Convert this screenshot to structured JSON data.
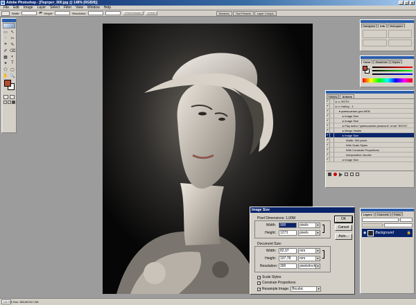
{
  "titlebar": {
    "title": "Adobe Photoshop - [Портрет_000.jpg @ 148% (RGB/8)]",
    "buttons": [
      "_",
      "□",
      "×"
    ]
  },
  "menu": [
    "File",
    "Edit",
    "Image",
    "Layer",
    "Select",
    "Filter",
    "View",
    "Window",
    "Help"
  ],
  "options_bar": {
    "width_label": "Width:",
    "height_label": "Height:",
    "resolution_label": "Resolution:",
    "front_image": "Front Image",
    "clear": "Clear"
  },
  "palette_well": [
    "Brushes",
    "Tool Presets",
    "Layer Comps"
  ],
  "colors": {
    "foreground": "#b34a32",
    "background": "#ffffff"
  },
  "tools": [
    "▭",
    "↖",
    "◌",
    "✂",
    "⌗",
    "✎",
    "✐",
    "⌫",
    "▦",
    "◐",
    "✦",
    "T",
    "⬠",
    "▢",
    "✋",
    "🔍"
  ],
  "navigator": {
    "tabs": [
      "Navigator",
      "Info",
      "Histogram"
    ]
  },
  "color_panel": {
    "tabs": [
      "Color",
      "Swatches",
      "Styles"
    ]
  },
  "history_actions": {
    "tabs": [
      "History",
      "Actions"
    ],
    "rows": [
      {
        "text": "ФОТО",
        "indent": 0,
        "type": "folder"
      },
      {
        "text": "Набор - 1",
        "indent": 0,
        "type": "folder"
      },
      {
        "text": "уменьшение для WEB",
        "indent": 1,
        "type": "action"
      },
      {
        "text": "Image Size",
        "indent": 2,
        "type": "step"
      },
      {
        "text": "Image Size",
        "indent": 2,
        "type": "step"
      },
      {
        "text": "Play action \"уменьшение резкости\" of set \"ФОТО\"",
        "indent": 2,
        "type": "step"
      },
      {
        "text": "Merge Visible",
        "indent": 2,
        "type": "step"
      },
      {
        "text": "Image Size",
        "indent": 2,
        "type": "step",
        "selected": true
      },
      {
        "text": "Width: 900 pixels",
        "indent": 3,
        "type": "detail"
      },
      {
        "text": "With Scale Styles",
        "indent": 3,
        "type": "detail"
      },
      {
        "text": "With Constrain Proportions",
        "indent": 3,
        "type": "detail"
      },
      {
        "text": "Interpolation: bicubic",
        "indent": 3,
        "type": "detail"
      },
      {
        "text": "Image Size",
        "indent": 2,
        "type": "step"
      }
    ]
  },
  "layers": {
    "tabs": [
      "Layers",
      "Channels",
      "Paths"
    ],
    "layer_name": "Background"
  },
  "image_size_dialog": {
    "title": "Image Size",
    "pixel_dimensions_label": "Pixel Dimensions:",
    "pixel_dimensions_value": "1,00M",
    "width_label": "Width:",
    "height_label": "Height:",
    "pixel_width": "900",
    "pixel_height": "1273",
    "pixel_unit": "pixels",
    "document_size_label": "Document Size:",
    "doc_width": "82,97",
    "doc_height": "107,78",
    "doc_unit": "mm",
    "resolution_label": "Resolution:",
    "resolution": "300",
    "resolution_unit": "pixels/inch",
    "scale_styles": "Scale Styles",
    "constrain": "Constrain Proportions",
    "resample": "Resample Image:",
    "resample_method": "Bicubic",
    "ok": "OK",
    "cancel": "Cancel",
    "auto": "Auto..."
  },
  "status": {
    "zoom": "148.9%",
    "doc": "Doc: 363,8K/317,2M"
  }
}
